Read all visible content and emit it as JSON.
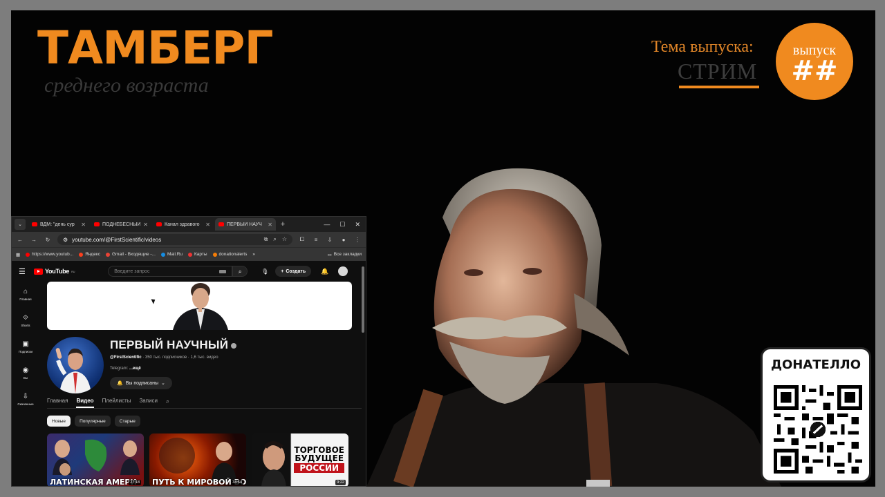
{
  "overlay": {
    "brand_title": "ТАМБЕРГ",
    "brand_subtitle": "среднего возраста",
    "topic_label": "Тема выпуска:",
    "topic_value": "СТРИМ",
    "issue_word": "выпуск",
    "issue_number": "##",
    "donate_title": "ДОНАТЕЛЛО",
    "accent_color": "#f08a1f"
  },
  "browser": {
    "tabs": [
      {
        "label": "ВДМ: \"день сур",
        "active": false
      },
      {
        "label": "ПОДНЕБЕСНЫЙ",
        "active": false
      },
      {
        "label": "Канал здравого",
        "active": false
      },
      {
        "label": "ПЕРВЫЙ НАУЧ",
        "active": true
      }
    ],
    "url": "youtube.com/@FirstScientific/videos",
    "bookmarks": [
      "https://www.youtub...",
      "Яндекс",
      "Gmail - Входящие -...",
      "Mail.Ru",
      "Карты",
      "donationalerts"
    ],
    "all_bookmarks": "Все закладки"
  },
  "youtube": {
    "logo": "YouTube",
    "logo_region": "RU",
    "search_placeholder": "Введите запрос",
    "create_label": "Создать",
    "sidebar": [
      {
        "label": "Главная",
        "icon": "home-icon"
      },
      {
        "label": "Shorts",
        "icon": "shorts-icon"
      },
      {
        "label": "Подписки",
        "icon": "subscriptions-icon"
      },
      {
        "label": "Вы",
        "icon": "you-icon"
      },
      {
        "label": "Скачанные",
        "icon": "downloads-icon"
      }
    ],
    "channel": {
      "name": "ПЕРВЫЙ НАУЧНЫЙ",
      "handle": "@FirstScientific",
      "stats": "· 350 тыс. подписчиков · 1,6 тыс. видео",
      "telegram_prefix": "Telegram:",
      "telegram_more": "...ещё",
      "subscribed_label": "Вы подписаны"
    },
    "channel_tabs": [
      "Главная",
      "Видео",
      "Плейлисты",
      "Записи"
    ],
    "active_tab": "Видео",
    "chips": [
      "Новые",
      "Популярные",
      "Старые"
    ],
    "videos": [
      {
        "title": "ЛАТИНСКАЯ АМЕРИ",
        "duration": "27:18"
      },
      {
        "title": "ПУТЬ К МИРОВОЙ ВОЙ",
        "duration": "34:54"
      },
      {
        "title_lines": [
          "ТОРГОВОЕ",
          "БУДУЩЕЕ",
          "РОССИИ"
        ],
        "duration": "9:22"
      }
    ]
  }
}
